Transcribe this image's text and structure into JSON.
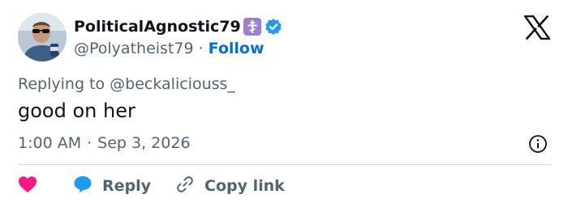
{
  "user": {
    "display_name": "PoliticalAgnostic79",
    "handle": "@Polyatheist79",
    "follow_label": "Follow",
    "separator": "·",
    "badge_icon": "orthodox-cross-icon",
    "verified_icon": "verified-check-icon"
  },
  "tweet": {
    "replying_to": "Replying to @beckaliciouss_",
    "text": "good on her",
    "time": "1:00 AM",
    "separator": "·",
    "date": "Sep 3, 2026"
  },
  "actions": {
    "like_icon": "heart-icon",
    "reply_label": "Reply",
    "copy_label": "Copy link"
  },
  "colors": {
    "text_primary": "#0f1419",
    "text_secondary": "#536471",
    "link_blue": "#1d9bf0",
    "follow_blue": "#006fd6",
    "heart_pink": "#f91880",
    "badge_purple": "#9b7fd1",
    "divider": "#cfd9de"
  }
}
